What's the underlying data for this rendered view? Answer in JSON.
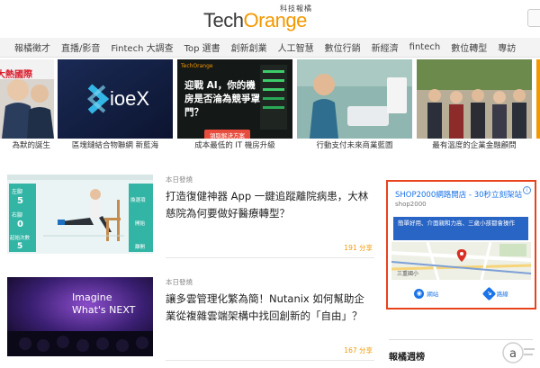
{
  "header": {
    "logo_tech": "Tech",
    "logo_orange": "Orange",
    "logo_sub": "科技報橘"
  },
  "nav": {
    "items": [
      "報橘徵才",
      "直播/影音",
      "Fintech 大調查",
      "Top 選書",
      "創新創業",
      "人工智慧",
      "數位行銷",
      "新經濟",
      "fintech",
      "數位轉型",
      "專訪"
    ]
  },
  "carousel": {
    "slides": [
      {
        "caption": "為默的誕生",
        "overlay": "大熱國際"
      },
      {
        "caption": "區塊鏈結合物聯網 新藍海",
        "overlay": "ioeX"
      },
      {
        "caption": "成本最低的 IT 機房升級",
        "overlay": "迎戰 AI，你的機房是否淪為競爭罩門？",
        "logo": "TechOrange",
        "button": "領取解決方案"
      },
      {
        "caption": "行動支付未來商業藍圖",
        "overlay": ""
      },
      {
        "caption": "最有溫度的企業金融顧問",
        "overlay": ""
      }
    ]
  },
  "articles": [
    {
      "category": "本日發燒",
      "title": "打造復健神器 App 一鍵追蹤離院病患，大林慈院為何要做好醫療轉型？",
      "shares": "191 分享",
      "thumb": {
        "btn1": "換選項",
        "btn2": "開始",
        "btn3": "離開",
        "l1": "左腳",
        "v1": "5",
        "l2": "右腳",
        "v2": "0",
        "l3": "起始次數",
        "v3": "5"
      }
    },
    {
      "category": "本日發燒",
      "title": "讓多雲管理化繁為簡！Nutanix 如何幫助企業從複雜雲端架構中找回創新的「自由」？",
      "shares": "167 分享",
      "thumb": {
        "line1": "Imagine",
        "line2": "What's NEXT"
      }
    }
  ],
  "ad": {
    "title": "SHOP2000網路開店 - 30秒立刻架站",
    "domain": "shop2000",
    "info": "i",
    "desc": "簡單好用、介面親和力高、三歲小孩都會操作",
    "map_label": "三重國小",
    "btn_site": "網站",
    "btn_route": "路線"
  },
  "sidebar": {
    "weekly_title": "報橘週榜"
  },
  "colors": {
    "brand_orange": "#f39800",
    "ad_border": "#e8431c",
    "ad_blue": "#2965c5"
  }
}
